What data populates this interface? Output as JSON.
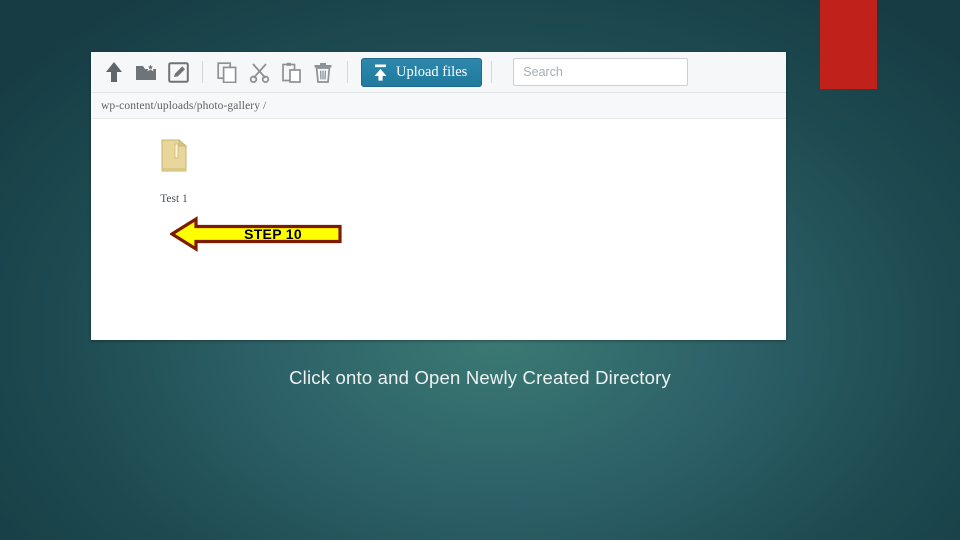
{
  "slide": {
    "caption": "Click onto and Open Newly Created Directory",
    "background_color": "#1d4a50",
    "accent_color": "#c1211b"
  },
  "panel": {
    "toolbar": {
      "icons": [
        {
          "name": "up-arrow-icon",
          "label": "Parent directory"
        },
        {
          "name": "new-folder-icon",
          "label": "New folder"
        },
        {
          "name": "edit-pencil-icon",
          "label": "Rename"
        },
        {
          "name": "copy-icon",
          "label": "Copy"
        },
        {
          "name": "cut-scissors-icon",
          "label": "Cut"
        },
        {
          "name": "paste-clipboard-icon",
          "label": "Paste"
        },
        {
          "name": "trash-icon",
          "label": "Delete"
        }
      ],
      "upload_button": {
        "label": "Upload files",
        "color": "#217a9e"
      },
      "search": {
        "value": "",
        "placeholder": "Search"
      }
    },
    "breadcrumb": "wp-content/uploads/photo-gallery /",
    "files": [
      {
        "name": "Test 1",
        "type": "folder"
      }
    ]
  },
  "annotation": {
    "step_label": "STEP 10",
    "fill_color": "#ffff00",
    "border_color": "#7d1a00",
    "direction": "left"
  }
}
